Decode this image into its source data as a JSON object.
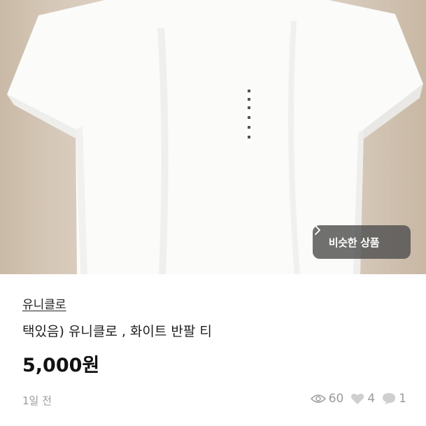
{
  "product": {
    "similar_button_label": "비슷한 상품",
    "shop_name": "유니클로",
    "title": "택있음) 유니클로 , 화이트 반팔 티",
    "price": "5,000원",
    "posted_time": "1일 전"
  },
  "stats": {
    "views": "60",
    "likes": "4",
    "chats": "1"
  },
  "icons": {
    "views": "eye-icon",
    "likes": "heart-icon",
    "chats": "chat-bubble-icon",
    "similar": "chevron-right-icon"
  },
  "colors": {
    "accent_text": "#1e1e1e",
    "muted_text": "#9a9a9a",
    "overlay_button": "#505050"
  }
}
